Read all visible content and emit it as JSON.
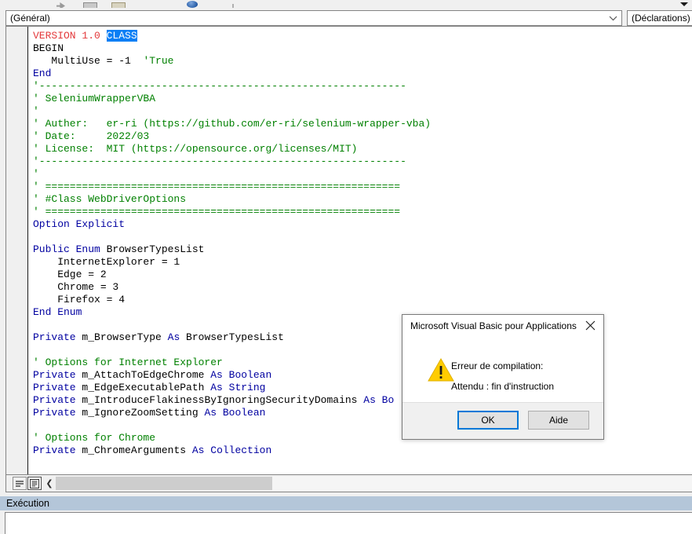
{
  "window": {
    "app_name": "Microsoft Visual Basic pour Applications"
  },
  "combo_bar": {
    "procedure_scope": "(Général)",
    "declarations": "(Déclarations)",
    "scope_arrow_icon": "chevron-down-icon",
    "declarations_arrow_icon": "chevron-down-icon"
  },
  "toolbar": {
    "run_icon": "run-play-icon",
    "break_icon": "break-icon",
    "reset_icon": "reset-stop-icon",
    "object_browser_icon": "object-browser-icon",
    "overflow_icon": "toolbar-overflow-chevron-icon"
  },
  "code": {
    "lines": [
      [
        {
          "t": "VERSION 1.0 ",
          "c": "tok-r"
        },
        {
          "t": "CLASS",
          "c": "tok-sel"
        }
      ],
      [
        {
          "t": "BEGIN",
          "c": "tok-d"
        }
      ],
      [
        {
          "t": "   MultiUse = -1  ",
          "c": "tok-d"
        },
        {
          "t": "'True",
          "c": "tok-c"
        }
      ],
      [
        {
          "t": "End",
          "c": "tok-k"
        }
      ],
      [
        {
          "t": "'------------------------------------------------------------",
          "c": "tok-c"
        }
      ],
      [
        {
          "t": "' SeleniumWrapperVBA",
          "c": "tok-c"
        }
      ],
      [
        {
          "t": "'",
          "c": "tok-c"
        }
      ],
      [
        {
          "t": "' Auther:   er-ri (https://github.com/er-ri/selenium-wrapper-vba)",
          "c": "tok-c"
        }
      ],
      [
        {
          "t": "' Date:     2022/03",
          "c": "tok-c"
        }
      ],
      [
        {
          "t": "' License:  MIT (https://opensource.org/licenses/MIT)",
          "c": "tok-c"
        }
      ],
      [
        {
          "t": "'------------------------------------------------------------",
          "c": "tok-c"
        }
      ],
      [
        {
          "t": "'",
          "c": "tok-c"
        }
      ],
      [
        {
          "t": "' ==========================================================",
          "c": "tok-c"
        }
      ],
      [
        {
          "t": "' #Class WebDriverOptions",
          "c": "tok-c"
        }
      ],
      [
        {
          "t": "' ==========================================================",
          "c": "tok-c"
        }
      ],
      [
        {
          "t": "Option Explicit",
          "c": "tok-k"
        }
      ],
      [
        {
          "t": "",
          "c": "tok-d"
        }
      ],
      [
        {
          "t": "Public Enum ",
          "c": "tok-k"
        },
        {
          "t": "BrowserTypesList",
          "c": "tok-d"
        }
      ],
      [
        {
          "t": "    InternetExplorer = 1",
          "c": "tok-d"
        }
      ],
      [
        {
          "t": "    Edge = 2",
          "c": "tok-d"
        }
      ],
      [
        {
          "t": "    Chrome = 3",
          "c": "tok-d"
        }
      ],
      [
        {
          "t": "    Firefox = 4",
          "c": "tok-d"
        }
      ],
      [
        {
          "t": "End Enum",
          "c": "tok-k"
        }
      ],
      [
        {
          "t": "",
          "c": "tok-d"
        }
      ],
      [
        {
          "t": "Private ",
          "c": "tok-k"
        },
        {
          "t": "m_BrowserType ",
          "c": "tok-d"
        },
        {
          "t": "As ",
          "c": "tok-k"
        },
        {
          "t": "BrowserTypesList",
          "c": "tok-d"
        }
      ],
      [
        {
          "t": "",
          "c": "tok-d"
        }
      ],
      [
        {
          "t": "' Options for Internet Explorer",
          "c": "tok-c"
        }
      ],
      [
        {
          "t": "Private ",
          "c": "tok-k"
        },
        {
          "t": "m_AttachToEdgeChrome ",
          "c": "tok-d"
        },
        {
          "t": "As Boolean",
          "c": "tok-k"
        }
      ],
      [
        {
          "t": "Private ",
          "c": "tok-k"
        },
        {
          "t": "m_EdgeExecutablePath ",
          "c": "tok-d"
        },
        {
          "t": "As String",
          "c": "tok-k"
        }
      ],
      [
        {
          "t": "Private ",
          "c": "tok-k"
        },
        {
          "t": "m_IntroduceFlakinessByIgnoringSecurityDomains ",
          "c": "tok-d"
        },
        {
          "t": "As Bo",
          "c": "tok-k"
        }
      ],
      [
        {
          "t": "Private ",
          "c": "tok-k"
        },
        {
          "t": "m_IgnoreZoomSetting ",
          "c": "tok-d"
        },
        {
          "t": "As Boolean",
          "c": "tok-k"
        }
      ],
      [
        {
          "t": "",
          "c": "tok-d"
        }
      ],
      [
        {
          "t": "' Options for Chrome",
          "c": "tok-c"
        }
      ],
      [
        {
          "t": "Private ",
          "c": "tok-k"
        },
        {
          "t": "m_ChromeArguments ",
          "c": "tok-d"
        },
        {
          "t": "As Collection",
          "c": "tok-k"
        }
      ]
    ]
  },
  "code_bottom": {
    "procedure_view_icon": "procedure-view-icon",
    "full_module_view_icon": "full-module-view-icon",
    "scroll_left_icon": "chevron-left-icon"
  },
  "immediate": {
    "title": "Exécution",
    "content": ""
  },
  "dialog": {
    "title": "Microsoft Visual Basic pour Applications",
    "close_icon": "close-icon",
    "warning_icon": "warning-triangle-icon",
    "message_line1": "Erreur de compilation:",
    "message_line2": "Attendu : fin d'instruction",
    "ok_label": "OK",
    "help_label": "Aide"
  },
  "colors": {
    "keyword": "#0000A0",
    "comment": "#008000",
    "version_red": "#E3393B",
    "selection_blue": "#0A7FF5",
    "default_button_border": "#0078D7",
    "immediate_titlebar": "#B4C6D9",
    "warning_yellow": "#FFCC00"
  }
}
